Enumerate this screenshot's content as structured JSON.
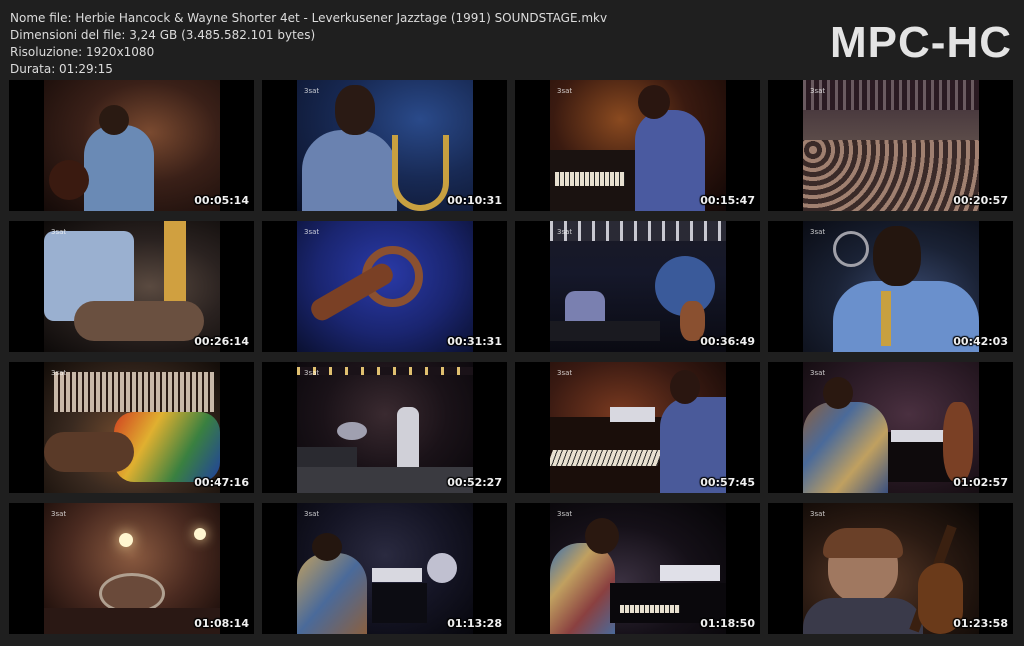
{
  "header": {
    "file_name": "Nome file: Herbie Hancock & Wayne Shorter 4et - Leverkusener Jazztage (1991) SOUNDSTAGE.mkv",
    "file_size": "Dimensioni del file: 3,24 GB (3.485.582.101 bytes)",
    "resolution": "Risoluzione: 1920x1080",
    "duration": "Durata: 01:29:15"
  },
  "logo": "MPC-HC",
  "thumbnails": [
    {
      "timestamp": "00:05:14"
    },
    {
      "timestamp": "00:10:31"
    },
    {
      "timestamp": "00:15:47"
    },
    {
      "timestamp": "00:20:57"
    },
    {
      "timestamp": "00:26:14"
    },
    {
      "timestamp": "00:31:31"
    },
    {
      "timestamp": "00:36:49"
    },
    {
      "timestamp": "00:42:03"
    },
    {
      "timestamp": "00:47:16"
    },
    {
      "timestamp": "00:52:27"
    },
    {
      "timestamp": "00:57:45"
    },
    {
      "timestamp": "01:02:57"
    },
    {
      "timestamp": "01:08:14"
    },
    {
      "timestamp": "01:13:28"
    },
    {
      "timestamp": "01:18:50"
    },
    {
      "timestamp": "01:23:58"
    }
  ]
}
